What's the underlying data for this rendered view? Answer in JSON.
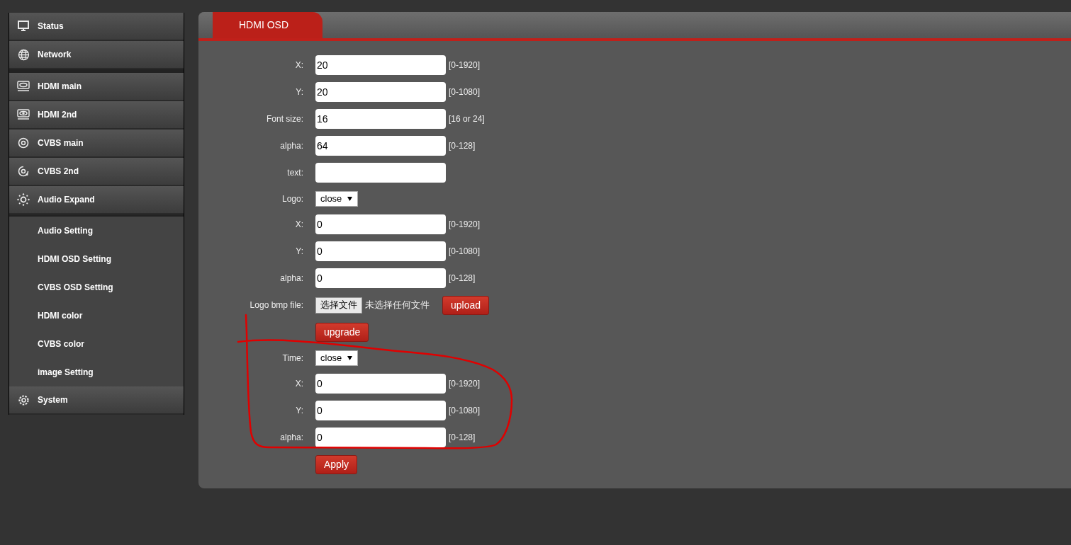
{
  "sidebar": {
    "sections": [
      {
        "items": [
          {
            "label": "Status"
          },
          {
            "label": "Network"
          }
        ]
      },
      {
        "items": [
          {
            "label": "HDMI main"
          },
          {
            "label": "HDMI 2nd"
          },
          {
            "label": "CVBS main"
          },
          {
            "label": "CVBS 2nd"
          },
          {
            "label": "Audio Expand",
            "expanded": true,
            "children": [
              {
                "label": "Audio Setting"
              },
              {
                "label": "HDMI OSD Setting"
              },
              {
                "label": "CVBS OSD Setting"
              },
              {
                "label": "HDMI color"
              },
              {
                "label": "CVBS color"
              },
              {
                "label": "image Setting"
              }
            ]
          },
          {
            "label": "System"
          }
        ]
      }
    ]
  },
  "tabs": [
    {
      "label": "HDMI OSD",
      "selected": true
    }
  ],
  "form": {
    "rows": [
      {
        "kind": "input",
        "label": "X:",
        "value": "20",
        "hint": "[0-1920]"
      },
      {
        "kind": "input",
        "label": "Y:",
        "value": "20",
        "hint": "[0-1080]"
      },
      {
        "kind": "input",
        "label": "Font size:",
        "value": "16",
        "hint": "[16 or 24]"
      },
      {
        "kind": "input",
        "label": "alpha:",
        "value": "64",
        "hint": "[0-128]"
      },
      {
        "kind": "input",
        "label": "text:"
      },
      {
        "kind": "select",
        "label": "Logo:",
        "value": "close"
      },
      {
        "kind": "input",
        "label": "X:",
        "value": "0",
        "hint": "[0-1920]"
      },
      {
        "kind": "input",
        "label": "Y:",
        "value": "0",
        "hint": "[0-1080]"
      },
      {
        "kind": "input",
        "label": "alpha:",
        "value": "0",
        "hint": "[0-128]"
      },
      {
        "kind": "file",
        "label": "Logo bmp file:",
        "button": "选择文件",
        "status": "未选择任何文件",
        "action": "upload"
      },
      {
        "kind": "button",
        "label": "upgrade"
      },
      {
        "kind": "select",
        "label": "Time:",
        "value": "close"
      },
      {
        "kind": "input",
        "label": "X:",
        "value": "0",
        "hint": "[0-1920]"
      },
      {
        "kind": "input",
        "label": "Y:",
        "value": "0",
        "hint": "[0-1080]"
      },
      {
        "kind": "input",
        "label": "alpha:",
        "value": "0",
        "hint": "[0-128]"
      },
      {
        "kind": "button",
        "label": "Apply"
      }
    ]
  }
}
